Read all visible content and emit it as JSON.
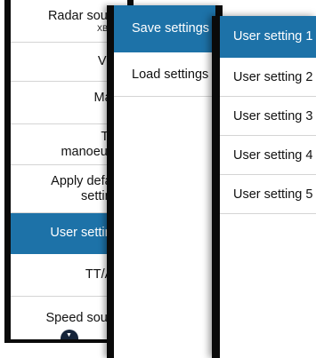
{
  "accent_color": "#1d72a8",
  "settings_menu": {
    "items": [
      {
        "label": "Radar source",
        "sub": "XBAND"
      },
      {
        "label": "View"
      },
      {
        "label": "Maps",
        "checked": true,
        "check_icon": "checkmark-icon"
      },
      {
        "label_line1": "Trial",
        "label_line2": "manoeuvre"
      },
      {
        "label_line1": "Apply default",
        "label_line2": "settings"
      },
      {
        "label": "User settings",
        "active": true
      },
      {
        "label": "TT/AIS"
      },
      {
        "label": "Speed source"
      }
    ],
    "scroll_icon": "chevron-down-icon"
  },
  "user_settings_menu": {
    "items": [
      {
        "label": "Save settings",
        "active": true
      },
      {
        "label": "Load settings"
      }
    ]
  },
  "save_slots_menu": {
    "items": [
      {
        "label": "User setting 1",
        "active": true
      },
      {
        "label": "User setting 2"
      },
      {
        "label": "User setting 3"
      },
      {
        "label": "User setting 4"
      },
      {
        "label": "User setting 5"
      }
    ]
  }
}
